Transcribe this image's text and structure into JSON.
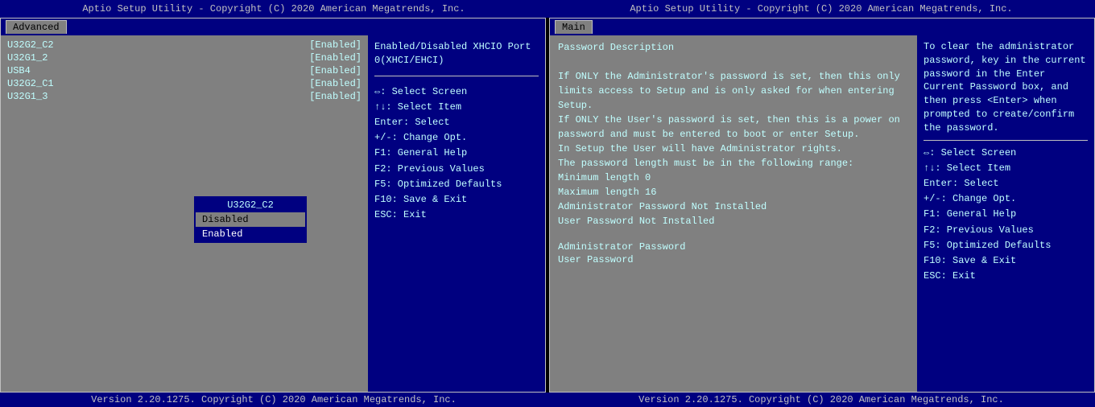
{
  "app": {
    "title": "Aptio Setup Utility - Copyright (C) 2020 American Megatrends, Inc.",
    "version": "Version 2.20.1275. Copyright (C) 2020 American Megatrends, Inc."
  },
  "left": {
    "tab": "Advanced",
    "settings": [
      {
        "name": "U32G2_C2",
        "value": "[Enabled]"
      },
      {
        "name": "U32G1_2",
        "value": "[Enabled]"
      },
      {
        "name": "USB4",
        "value": "[Enabled]"
      },
      {
        "name": "U32G2_C1",
        "value": "[Enabled]"
      },
      {
        "name": "U32G1_3",
        "value": "[Enabled]"
      }
    ],
    "dropdown": {
      "title": "U32G2_C2",
      "options": [
        "Disabled",
        "Enabled"
      ],
      "selected": "Enabled"
    },
    "description": "Enabled/Disabled XHCIO Port 0(XHCI/EHCI)",
    "keyhelp": [
      "⇔: Select Screen",
      "↑↓: Select Item",
      "Enter: Select",
      "+/-: Change Opt.",
      "F1: General Help",
      "F2: Previous Values",
      "F5: Optimized Defaults",
      "F10: Save & Exit",
      "ESC: Exit"
    ]
  },
  "right": {
    "tab": "Main",
    "description_lines": [
      "Password Description",
      "",
      "If ONLY the Administrator's password is set, then this only",
      "limits access to Setup and is only asked for when entering",
      "Setup.",
      "If ONLY the User's password is set, then this is a power on",
      "password and must be entered to boot or enter Setup.",
      "In Setup the User will have Administrator rights.",
      "The password length must be in the following range:",
      "Minimum length              0",
      "Maximum length              16",
      "Administrator Password      Not Installed",
      "User Password               Not Installed"
    ],
    "links": [
      "Administrator Password",
      "User Password"
    ],
    "sidebar_description": "To clear the administrator password, key in the current password in the Enter Current Password box, and then press <Enter> when prompted to create/confirm the password.",
    "keyhelp": [
      "⇔: Select Screen",
      "↑↓: Select Item",
      "Enter: Select",
      "+/-: Change Opt.",
      "F1: General Help",
      "F2: Previous Values",
      "F5: Optimized Defaults",
      "F10: Save & Exit",
      "ESC: Exit"
    ]
  }
}
